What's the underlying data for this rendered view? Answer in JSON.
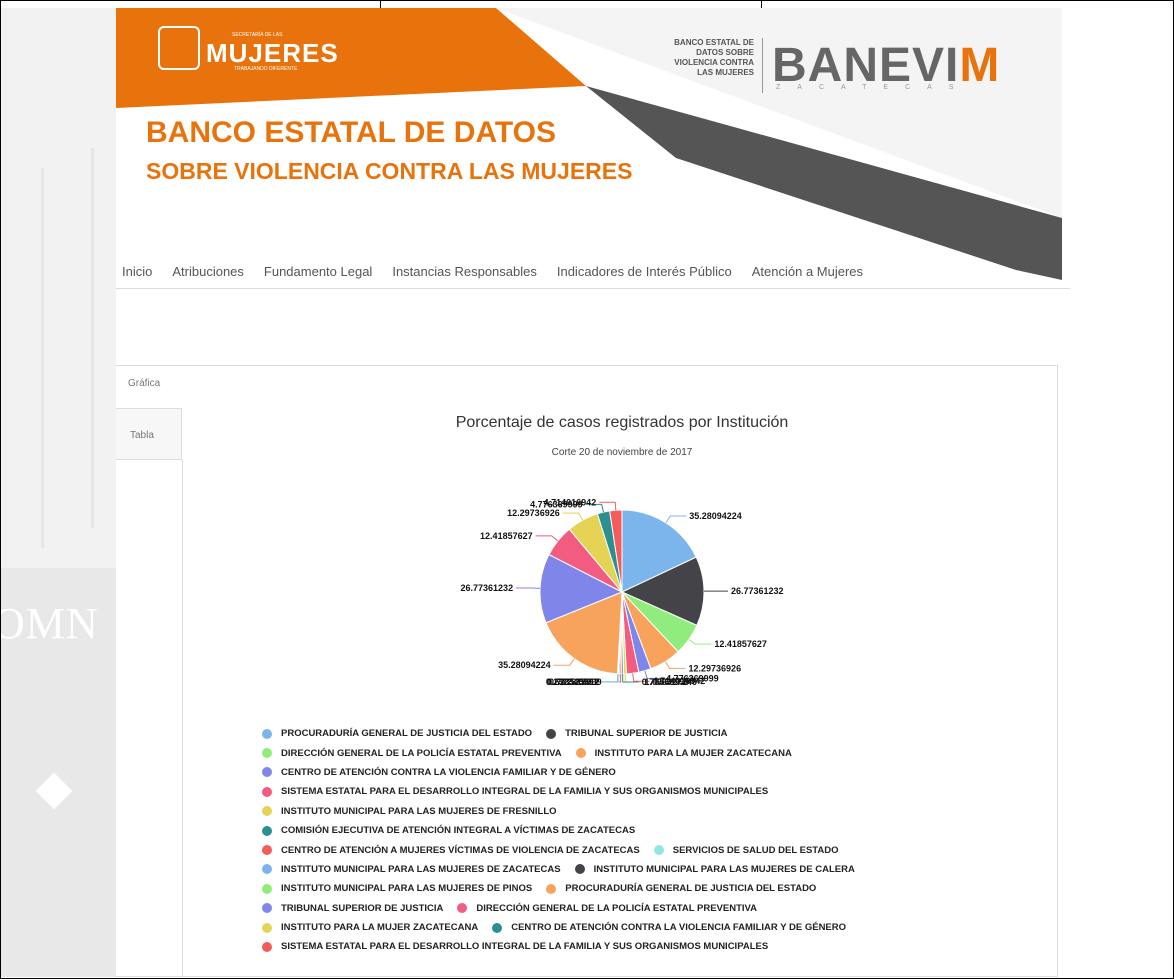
{
  "header": {
    "logo_text": "MUJERES",
    "logo_sub_top": "SECRETARÍA DE LAS",
    "logo_sub_bottom": "TRABAJANDO DIFERENTE",
    "banevim_small": [
      "BANCO ESTATAL DE",
      "DATOS SOBRE",
      "VIOLENCIA CONTRA",
      "LAS MUJERES"
    ],
    "banevim_big": "BANEVI",
    "banevim_m": "M",
    "banevim_zac": "ZACATECAS",
    "title_line1": "BANCO ESTATAL DE DATOS",
    "title_line2": "SOBRE VIOLENCIA CONTRA LAS MUJERES",
    "left_deco_text": "OMN"
  },
  "colors": {
    "orange": "#e8730c",
    "dark": "#444444"
  },
  "nav": {
    "items": [
      "Inicio",
      "Atribuciones",
      "Fundamento Legal",
      "Instancias Responsables",
      "Indicadores de Interés Público",
      "Atención a Mujeres"
    ]
  },
  "tabs": {
    "grafica": "Gráfica",
    "tabla": "Tabla"
  },
  "chart_data": {
    "type": "pie",
    "title": "Porcentaje de casos registrados por Institución",
    "subtitle": "Corte 20 de noviembre de 2017",
    "slices": [
      {
        "label": "35.28094224",
        "value": 35.28094224,
        "color": "#7cb5ec"
      },
      {
        "label": "26.77361232",
        "value": 26.77361232,
        "color": "#434348"
      },
      {
        "label": "12.41857627",
        "value": 12.41857627,
        "color": "#90ed7d"
      },
      {
        "label": "12.29736926",
        "value": 12.29736926,
        "color": "#f7a35c"
      },
      {
        "label": "4.776369999",
        "value": 4.776369999,
        "color": "#8085e9"
      },
      {
        "label": "4.714016942",
        "value": 4.714016942,
        "color": "#f15c80"
      },
      {
        "label": "1.099927146",
        "value": 1.099927146,
        "color": "#e4d354"
      },
      {
        "label": "0.73566999",
        "value": 0.73566999,
        "color": "#2b908f"
      },
      {
        "label": "0.722315999",
        "value": 0.722315999,
        "color": "#f45b5b"
      },
      {
        "label": "0.623525512",
        "value": 0.623525512,
        "color": "#91e8e1"
      },
      {
        "label": "0.232340991",
        "value": 0.232340991,
        "color": "#7cb5ec"
      },
      {
        "label": "35.28094224",
        "value": 35.28094224,
        "color": "#f7a35c"
      },
      {
        "label": "26.77361232",
        "value": 26.77361232,
        "color": "#8085e9"
      },
      {
        "label": "12.41857627",
        "value": 12.41857627,
        "color": "#f15c80"
      },
      {
        "label": "12.29736926",
        "value": 12.29736926,
        "color": "#e4d354"
      },
      {
        "label": "4.776369999",
        "value": 4.776369999,
        "color": "#2b908f"
      },
      {
        "label": "4.714016942",
        "value": 4.714016942,
        "color": "#f45b5b"
      }
    ],
    "legend": [
      [
        {
          "text": "PROCURADURÍA GENERAL DE JUSTICIA DEL ESTADO",
          "color": "#7cb5ec"
        },
        {
          "text": "TRIBUNAL SUPERIOR DE JUSTICIA",
          "color": "#434348"
        }
      ],
      [
        {
          "text": "DIRECCIÓN GENERAL DE LA POLICÍA ESTATAL PREVENTIVA",
          "color": "#90ed7d"
        },
        {
          "text": "INSTITUTO PARA LA MUJER ZACATECANA",
          "color": "#f7a35c"
        }
      ],
      [
        {
          "text": "CENTRO DE ATENCIÓN CONTRA LA VIOLENCIA FAMILIAR Y DE GÉNERO",
          "color": "#8085e9"
        }
      ],
      [
        {
          "text": "SISTEMA ESTATAL PARA EL DESARROLLO INTEGRAL DE LA FAMILIA Y SUS ORGANISMOS MUNICIPALES",
          "color": "#f15c80"
        }
      ],
      [
        {
          "text": "INSTITUTO MUNICIPAL PARA LAS MUJERES DE FRESNILLO",
          "color": "#e4d354"
        }
      ],
      [
        {
          "text": "COMISIÓN EJECUTIVA DE ATENCIÓN INTEGRAL A VÍCTIMAS DE ZACATECAS",
          "color": "#2b908f"
        }
      ],
      [
        {
          "text": "CENTRO DE ATENCIÓN A MUJERES VÍCTIMAS DE VIOLENCIA DE ZACATECAS",
          "color": "#f45b5b"
        },
        {
          "text": "SERVICIOS DE SALUD DEL ESTADO",
          "color": "#91e8e1"
        }
      ],
      [
        {
          "text": "INSTITUTO MUNICIPAL PARA LAS MUJERES DE ZACATECAS",
          "color": "#7cb5ec"
        },
        {
          "text": "INSTITUTO MUNICIPAL PARA LAS MUJERES DE CALERA",
          "color": "#434348"
        }
      ],
      [
        {
          "text": "INSTITUTO MUNICIPAL PARA LAS MUJERES DE PINOS",
          "color": "#90ed7d"
        },
        {
          "text": "PROCURADURÍA GENERAL DE JUSTICIA DEL ESTADO",
          "color": "#f7a35c"
        }
      ],
      [
        {
          "text": "TRIBUNAL SUPERIOR DE JUSTICIA",
          "color": "#8085e9"
        },
        {
          "text": "DIRECCIÓN GENERAL DE LA POLICÍA ESTATAL PREVENTIVA",
          "color": "#f15c80"
        }
      ],
      [
        {
          "text": "INSTITUTO PARA LA MUJER ZACATECANA",
          "color": "#e4d354"
        },
        {
          "text": "CENTRO DE ATENCIÓN CONTRA LA VIOLENCIA FAMILIAR Y DE GÉNERO",
          "color": "#2b908f"
        }
      ],
      [
        {
          "text": "SISTEMA ESTATAL PARA EL DESARROLLO INTEGRAL DE LA FAMILIA Y SUS ORGANISMOS MUNICIPALES",
          "color": "#f45b5b"
        }
      ]
    ]
  }
}
